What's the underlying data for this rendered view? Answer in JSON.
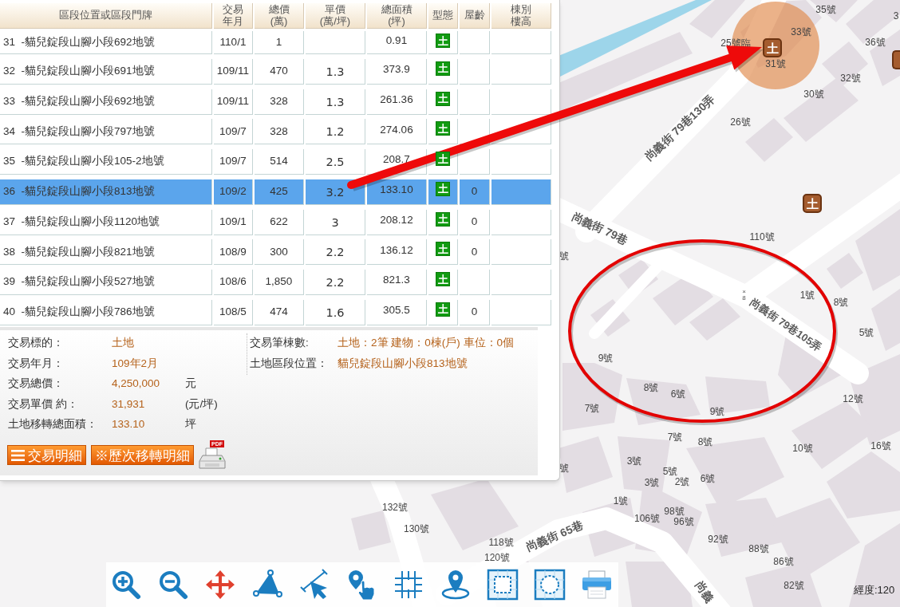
{
  "table": {
    "columns": [
      "區段位置或區段門牌",
      "交易年月",
      "總價\n(萬)",
      "單價\n(萬/坪)",
      "總面積\n(坪)",
      "型態",
      "屋齡",
      "棟別樓高"
    ],
    "rows": [
      {
        "location": "31  -貓兒錠段山腳小段692地號",
        "date": "110/1",
        "total_price": "1",
        "area": "0.91",
        "type": "土",
        "selected": false
      },
      {
        "location": "32  -貓兒錠段山腳小段691地號",
        "date": "109/11",
        "total_price": "470",
        "unit_price": "1.3",
        "area": "373.9",
        "type": "土",
        "selected": false
      },
      {
        "location": "33  -貓兒錠段山腳小段692地號",
        "date": "109/11",
        "total_price": "328",
        "unit_price": "1.3",
        "area": "261.36",
        "type": "土",
        "selected": false
      },
      {
        "location": "34  -貓兒錠段山腳小段797地號",
        "date": "109/7",
        "total_price": "328",
        "unit_price": "1.2",
        "area": "274.06",
        "type": "土",
        "selected": false
      },
      {
        "location": "35  -貓兒錠段山腳小段105-2地號",
        "date": "109/7",
        "total_price": "514",
        "unit_price": "2.5",
        "area": "208.7",
        "type": "土",
        "selected": false
      },
      {
        "location": "36  -貓兒錠段山腳小段813地號",
        "date": "109/2",
        "total_price": "425",
        "unit_price": "3.2",
        "area": "133.10",
        "type": "土",
        "age": "0",
        "selected": true
      },
      {
        "location": "37  -貓兒錠段山腳小段1120地號",
        "date": "109/1",
        "total_price": "622",
        "unit_price": "3",
        "area": "208.12",
        "type": "土",
        "age": "0",
        "selected": false
      },
      {
        "location": "38  -貓兒錠段山腳小段821地號",
        "date": "108/9",
        "total_price": "300",
        "unit_price": "2.2",
        "area": "136.12",
        "type": "土",
        "age": "0",
        "selected": false
      },
      {
        "location": "39  -貓兒錠段山腳小段527地號",
        "date": "108/6",
        "total_price": "1,850",
        "unit_price": "2.2",
        "area": "821.3",
        "type": "土",
        "selected": false
      },
      {
        "location": "40  -貓兒錠段山腳小段786地號",
        "date": "108/5",
        "total_price": "474",
        "unit_price": "1.6",
        "area": "305.5",
        "type": "土",
        "age": "0",
        "selected": false
      }
    ]
  },
  "details": {
    "left": [
      {
        "label": "交易標的：",
        "value": "土地"
      },
      {
        "label": "交易年月：",
        "value": "109年2月"
      },
      {
        "label": "交易總價：",
        "value": "4,250,000",
        "unit": "元"
      },
      {
        "label": "交易單價 約：",
        "value": "31,931",
        "unit": "(元/坪)"
      },
      {
        "label": "土地移轉總面積：",
        "value": "133.10",
        "unit": "坪"
      }
    ],
    "right": [
      {
        "label": "交易筆棟數:",
        "value": "土地：2筆 建物：0棟(戶) 車位：0個"
      },
      {
        "label": "土地區段位置：",
        "value": "貓兒錠段山腳小段813地號"
      }
    ]
  },
  "buttons": [
    {
      "kind": "list",
      "label": "交易明細"
    },
    {
      "kind": "plain",
      "label": "※歷次移轉明細"
    }
  ],
  "pdf_print": {
    "badge": "PDF"
  },
  "map": {
    "house_labels": [
      "35號",
      "33號",
      "25號臨",
      "31號",
      "36號",
      "3",
      "32號",
      "30號",
      "26號",
      "110號",
      "號",
      "1號",
      "8號",
      "5號",
      "12號",
      "9號",
      "8號",
      "6號",
      "9號",
      "7號",
      "7號",
      "8號",
      "10號",
      "16號",
      "3號",
      "5號",
      "3號",
      "2號",
      "6號",
      "1號",
      "106號",
      "98號",
      "96號",
      "92號",
      "88號",
      "86號",
      "82號",
      "132號",
      "130號",
      "118號",
      "120號",
      "號"
    ],
    "street_labels": [
      "尚義街 79巷130弄",
      "尚義街 79巷",
      "尚義街 79巷105弄",
      "尚義街 65巷",
      "尚義"
    ],
    "node_label": "×8",
    "markers": [
      {
        "label": "土"
      },
      {
        "label": "土"
      }
    ],
    "coordinate": "經度:120"
  },
  "toolbar": [
    {
      "kind": "zoomin"
    },
    {
      "kind": "zoomout"
    },
    {
      "kind": "pan"
    },
    {
      "kind": "area"
    },
    {
      "kind": "distance"
    },
    {
      "kind": "identify"
    },
    {
      "kind": "grid"
    },
    {
      "kind": "locate"
    },
    {
      "kind": "rectselect"
    },
    {
      "kind": "circleselect"
    },
    {
      "kind": "print"
    }
  ]
}
